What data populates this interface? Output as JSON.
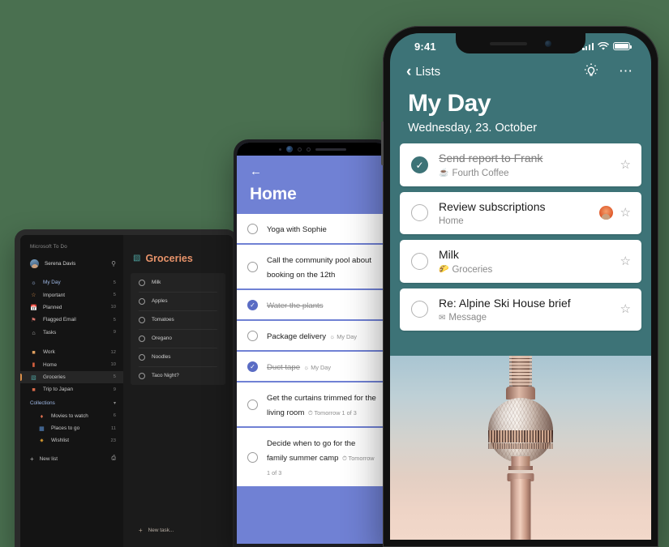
{
  "background_color": "#4a7050",
  "tablet": {
    "theme_background": "#141414",
    "app_name": "Microsoft To Do",
    "user": {
      "name": "Serena Davis",
      "search_icon": "search-icon"
    },
    "smart_lists": [
      {
        "icon": "sun-icon",
        "label": "My Day",
        "count": "5",
        "accent": true
      },
      {
        "icon": "star-icon",
        "label": "Important",
        "count": "5",
        "accent": false
      },
      {
        "icon": "calendar-icon",
        "label": "Planned",
        "count": "10",
        "accent": false
      },
      {
        "icon": "flag-icon",
        "label": "Flagged Email",
        "count": "5",
        "accent": false
      },
      {
        "icon": "house-icon",
        "label": "Tasks",
        "count": "9",
        "accent": false
      }
    ],
    "user_lists": [
      {
        "icon": "book-icon",
        "label": "Work",
        "count": "12",
        "selected": false
      },
      {
        "icon": "book-red-icon",
        "label": "Home",
        "count": "10",
        "selected": false
      },
      {
        "icon": "groceries-icon",
        "label": "Groceries",
        "count": "5",
        "selected": true
      },
      {
        "icon": "suitcase-icon",
        "label": "Trip to Japan",
        "count": "9",
        "selected": false
      }
    ],
    "collections": {
      "label": "Collections",
      "chevron_icon": "chevron-down-icon",
      "items": [
        {
          "icon": "popcorn-icon",
          "label": "Movies to watch",
          "count": "6"
        },
        {
          "icon": "map-icon",
          "label": "Places to go",
          "count": "11"
        },
        {
          "icon": "star-gold-icon",
          "label": "Wishlist",
          "count": "23"
        }
      ]
    },
    "new_list": {
      "icon": "plus-icon",
      "label": "New list",
      "right_icon": "new-group-icon"
    },
    "pane": {
      "icon": "groceries-icon",
      "title": "Groceries",
      "title_color": "#e8936a",
      "tasks": [
        {
          "label": "Milk"
        },
        {
          "label": "Apples"
        },
        {
          "label": "Tomatoes"
        },
        {
          "label": "Oregano"
        },
        {
          "label": "Noodles"
        },
        {
          "label": "Taco Night?"
        }
      ],
      "new_task": {
        "icon": "plus-icon",
        "label": "New task..."
      }
    }
  },
  "phone_middle": {
    "accent_color": "#7081d4",
    "back_icon": "arrow-left-icon",
    "title": "Home",
    "tasks": [
      {
        "name": "Yoga with Sophie",
        "meta": "",
        "meta_icon": "",
        "done": false
      },
      {
        "name": "Call the community pool about booking on the 12th",
        "meta": "",
        "meta_icon": "",
        "done": false
      },
      {
        "name": "Water the plants",
        "meta": "",
        "meta_icon": "",
        "done": true
      },
      {
        "name": "Package delivery",
        "meta": "My Day",
        "meta_icon": "sun-icon",
        "done": false
      },
      {
        "name": "Duct tape",
        "meta": "My Day",
        "meta_icon": "sun-icon",
        "done": true
      },
      {
        "name": "Get the curtains trimmed for the living room",
        "meta": "Tomorrow  1 of 3",
        "meta_icon": "bell-icon",
        "done": false
      },
      {
        "name": "Decide when to go for the family summer camp",
        "meta": "Tomorrow  1 of 3",
        "meta_icon": "bell-icon",
        "done": false
      }
    ]
  },
  "phone_right": {
    "accent_color": "#3d7377",
    "status_bar": {
      "time": "9:41",
      "signal_icon": "cellular-bars-icon",
      "wifi_icon": "wifi-icon",
      "battery_icon": "battery-full-icon"
    },
    "nav": {
      "back_icon": "chevron-left-icon",
      "back_label": "Lists",
      "theme_icon": "lightbulb-icon",
      "more_icon": "more-horizontal-icon"
    },
    "title": "My Day",
    "date": "Wednesday, 23. October",
    "tasks": [
      {
        "name": "Send report to Frank",
        "meta": "Fourth Coffee",
        "meta_icon": "coffee-icon",
        "done": true,
        "assignee": false,
        "star_icon": "star-outline-icon"
      },
      {
        "name": "Review subscriptions",
        "meta": "Home",
        "meta_icon": "",
        "done": false,
        "assignee": true,
        "star_icon": "star-outline-icon"
      },
      {
        "name": "Milk",
        "meta": "Groceries",
        "meta_icon": "taco-icon",
        "done": false,
        "assignee": false,
        "star_icon": "star-outline-icon"
      },
      {
        "name": "Re: Alpine Ski House brief",
        "meta": "Message",
        "meta_icon": "envelope-icon",
        "done": false,
        "assignee": false,
        "star_icon": "star-outline-icon"
      }
    ],
    "wallpaper": "berlin-tv-tower-photo"
  }
}
